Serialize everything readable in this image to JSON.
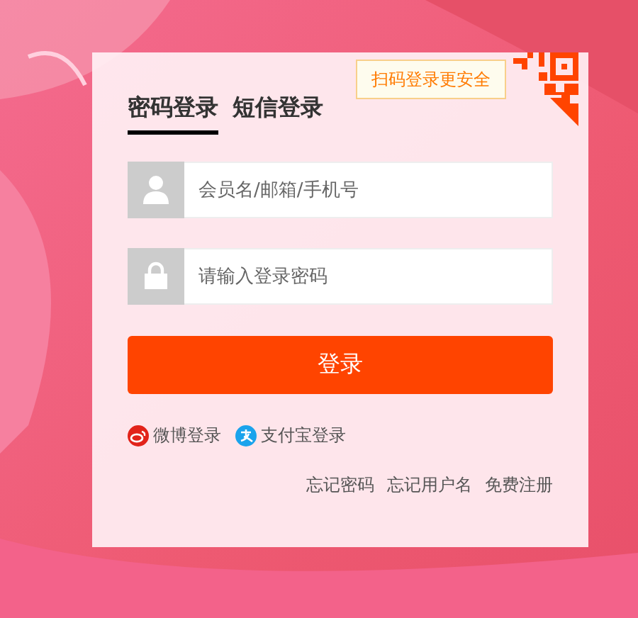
{
  "qr_hint": "扫码登录更安全",
  "tabs": [
    {
      "label": "密码登录",
      "selected": true
    },
    {
      "label": "短信登录",
      "selected": false
    }
  ],
  "fields": [
    {
      "kind": "user",
      "placeholder": "会员名/邮箱/手机号"
    },
    {
      "kind": "password",
      "placeholder": "请输入登录密码"
    }
  ],
  "submit": "登录",
  "social": [
    {
      "kind": "weibo",
      "label": "微博登录"
    },
    {
      "kind": "alipay",
      "label": "支付宝登录"
    }
  ],
  "links": [
    "忘记密码",
    "忘记用户名",
    "免费注册"
  ]
}
